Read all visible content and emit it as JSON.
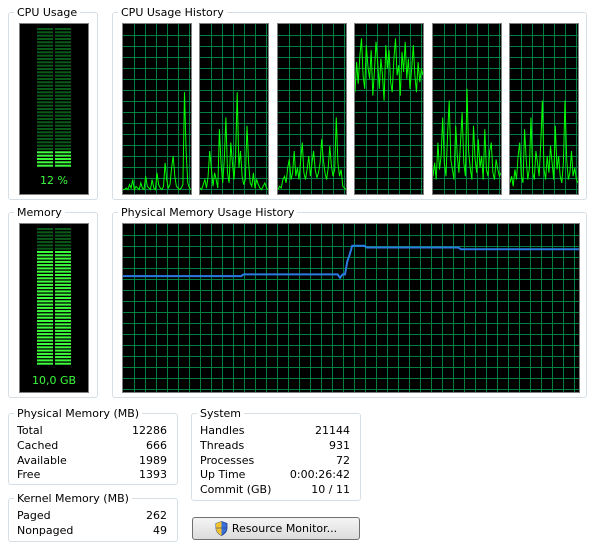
{
  "cpu": {
    "title": "CPU Usage",
    "value_label": "12 %",
    "percent": 12
  },
  "cpu_history": {
    "title": "CPU Usage History",
    "cores": [
      [
        2,
        2,
        3,
        2,
        5,
        3,
        8,
        2,
        4,
        3,
        2,
        6,
        3,
        2,
        10,
        4,
        3,
        2,
        8,
        3,
        2,
        12,
        5,
        3,
        2,
        4,
        18,
        8,
        3,
        5,
        15,
        22,
        10,
        4,
        3,
        2,
        3,
        5,
        60,
        25,
        6,
        3,
        2
      ],
      [
        3,
        2,
        5,
        8,
        3,
        10,
        25,
        15,
        4,
        12,
        8,
        3,
        38,
        18,
        6,
        20,
        45,
        12,
        6,
        30,
        18,
        8,
        22,
        60,
        15,
        25,
        10,
        5,
        8,
        40,
        18,
        6,
        4,
        12,
        3,
        8,
        5,
        3,
        2,
        4,
        6,
        3,
        2
      ],
      [
        2,
        4,
        3,
        8,
        10,
        6,
        15,
        20,
        8,
        12,
        25,
        10,
        15,
        8,
        20,
        30,
        12,
        8,
        14,
        22,
        10,
        18,
        25,
        14,
        9,
        12,
        18,
        32,
        20,
        12,
        8,
        15,
        28,
        16,
        10,
        14,
        45,
        18,
        10,
        14,
        4,
        3,
        2
      ],
      [
        60,
        78,
        65,
        82,
        92,
        70,
        62,
        88,
        75,
        68,
        85,
        58,
        72,
        90,
        78,
        62,
        80,
        70,
        55,
        88,
        74,
        85,
        66,
        60,
        80,
        92,
        70,
        76,
        58,
        84,
        72,
        90,
        68,
        80,
        62,
        74,
        88,
        70,
        60,
        78,
        66,
        74,
        70
      ],
      [
        10,
        18,
        8,
        30,
        14,
        22,
        45,
        18,
        10,
        35,
        55,
        20,
        14,
        8,
        40,
        22,
        12,
        30,
        48,
        18,
        10,
        62,
        25,
        15,
        8,
        40,
        20,
        12,
        32,
        15,
        22,
        8,
        38,
        14,
        10,
        25,
        30,
        12,
        8,
        20,
        14,
        10,
        12
      ],
      [
        6,
        10,
        4,
        14,
        8,
        22,
        30,
        10,
        6,
        38,
        20,
        8,
        15,
        45,
        12,
        8,
        25,
        18,
        10,
        30,
        55,
        14,
        8,
        22,
        12,
        28,
        18,
        8,
        40,
        14,
        22,
        10,
        6,
        18,
        55,
        20,
        8,
        12,
        25,
        10,
        15,
        8,
        6
      ]
    ]
  },
  "memory": {
    "title": "Memory",
    "value_label": "10,0 GB",
    "fraction": 0.84
  },
  "memory_history": {
    "title": "Physical Memory Usage History",
    "values": [
      69,
      69,
      69,
      69,
      69,
      69,
      69,
      69,
      69,
      69,
      69,
      69,
      69,
      69,
      69,
      69,
      69,
      69,
      69,
      69,
      69,
      69,
      69,
      69,
      69,
      69,
      69,
      69,
      69,
      69,
      69,
      69,
      69,
      69,
      69,
      69,
      69,
      69,
      69,
      69,
      69,
      69,
      69,
      69,
      69,
      69,
      69,
      69,
      69,
      69,
      70,
      70,
      70,
      70,
      70,
      70,
      70,
      70,
      70,
      70,
      70,
      70,
      70,
      70,
      70,
      70,
      70,
      70,
      70,
      70,
      70,
      70,
      70,
      70,
      70,
      70,
      70,
      70,
      70,
      70,
      70,
      70,
      70,
      70,
      70,
      70,
      70,
      70,
      70,
      70,
      68,
      70,
      70,
      78,
      82,
      87,
      87,
      87,
      87,
      87,
      87,
      86,
      86,
      86,
      86,
      86,
      86,
      86,
      86,
      86,
      86,
      86,
      86,
      86,
      86,
      86,
      86,
      86,
      86,
      86,
      86,
      86,
      86,
      86,
      86,
      86,
      86,
      86,
      86,
      86,
      86,
      86,
      86,
      86,
      86,
      86,
      86,
      86,
      86,
      86,
      85,
      85,
      85,
      85,
      85,
      85,
      85,
      85,
      85,
      85,
      85,
      85,
      85,
      85,
      85,
      85,
      85,
      85,
      85,
      85,
      85,
      85,
      85,
      85,
      85,
      85,
      85,
      85,
      85,
      85,
      85,
      85,
      85,
      85,
      85,
      85,
      85,
      85,
      85,
      85,
      85,
      85,
      85,
      85,
      85,
      85,
      85,
      85,
      85,
      85
    ],
    "line_color": "#2a7ae2"
  },
  "physical_memory": {
    "title": "Physical Memory (MB)",
    "rows": [
      {
        "label": "Total",
        "value": "12286"
      },
      {
        "label": "Cached",
        "value": "666"
      },
      {
        "label": "Available",
        "value": "1989"
      },
      {
        "label": "Free",
        "value": "1393"
      }
    ]
  },
  "kernel_memory": {
    "title": "Kernel Memory (MB)",
    "rows": [
      {
        "label": "Paged",
        "value": "262"
      },
      {
        "label": "Nonpaged",
        "value": "49"
      }
    ]
  },
  "system": {
    "title": "System",
    "rows": [
      {
        "label": "Handles",
        "value": "21144"
      },
      {
        "label": "Threads",
        "value": "931"
      },
      {
        "label": "Processes",
        "value": "72"
      },
      {
        "label": "Up Time",
        "value": "0:00:26:42"
      },
      {
        "label": "Commit (GB)",
        "value": "10 / 11"
      }
    ]
  },
  "resource_monitor_button": {
    "label": "Resource Monitor..."
  },
  "colors": {
    "graph_bg": "#000000",
    "grid": "#008040",
    "cpu_line": "#00ff00",
    "meter_on": "#3cfc3c",
    "meter_off": "#0a5a1a"
  }
}
